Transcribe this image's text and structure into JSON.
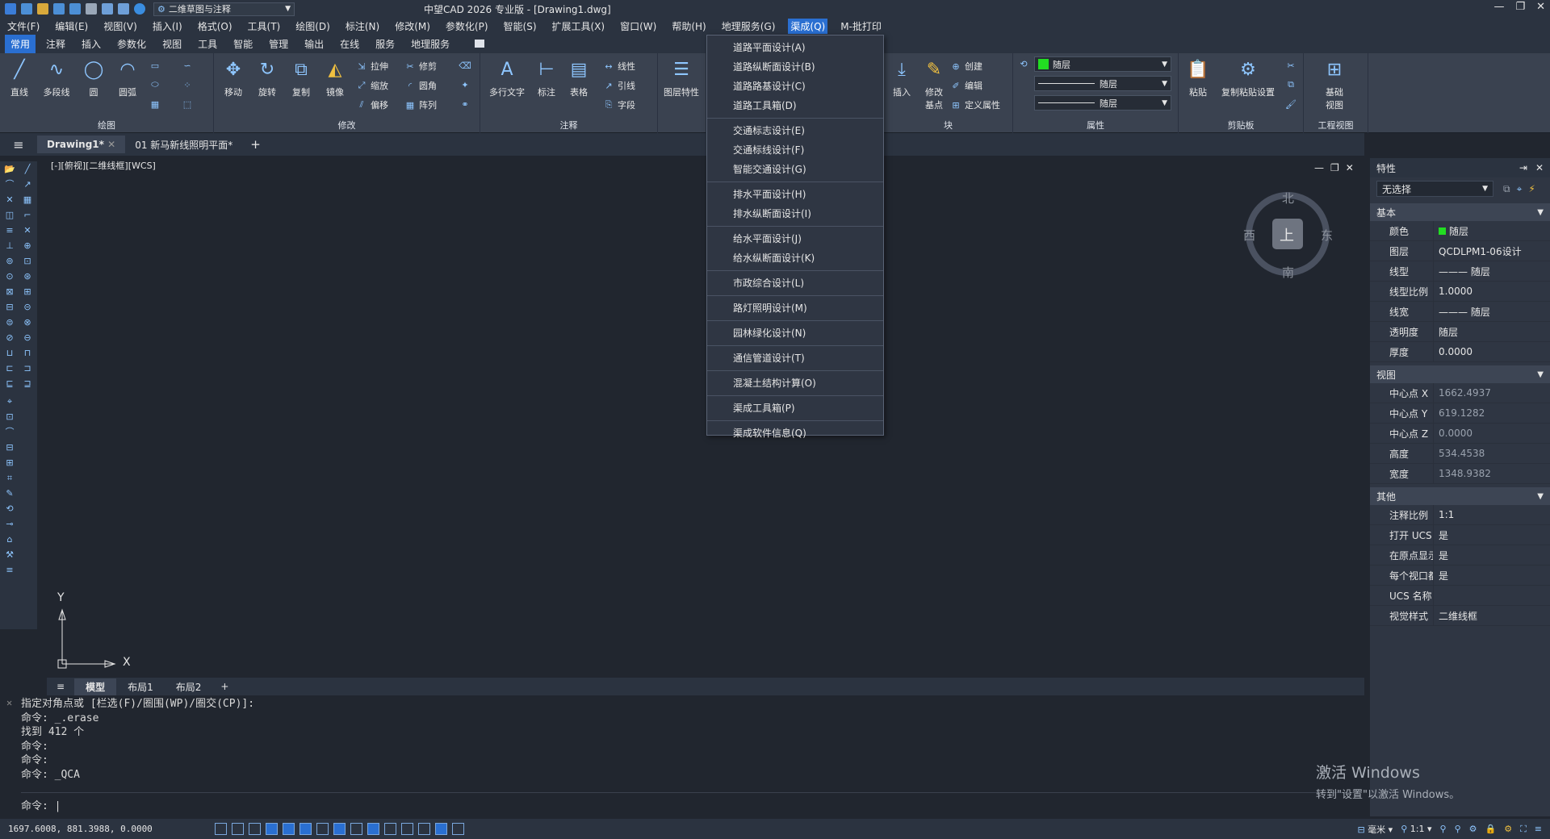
{
  "window": {
    "workspace": "二维草图与注释",
    "title": "中望CAD 2026 专业版 - [Drawing1.dwg]",
    "controls": [
      "—",
      "❐",
      "✕"
    ]
  },
  "menubar": [
    "文件(F)",
    "编辑(E)",
    "视图(V)",
    "插入(I)",
    "格式(O)",
    "工具(T)",
    "绘图(D)",
    "标注(N)",
    "修改(M)",
    "参数化(P)",
    "智能(S)",
    "扩展工具(X)",
    "窗口(W)",
    "帮助(H)",
    "地理服务(G)",
    "渠成(Q)",
    "M-批打印"
  ],
  "ribbon_tabs": [
    "常用",
    "注释",
    "插入",
    "参数化",
    "视图",
    "工具",
    "智能",
    "管理",
    "输出",
    "在线",
    "服务",
    "地理服务"
  ],
  "ribbon": {
    "draw": {
      "label": "绘图",
      "line": "直线",
      "polyline": "多段线",
      "circle": "圆",
      "arc": "圆弧"
    },
    "modify": {
      "label": "修改",
      "move": "移动",
      "rotate": "旋转",
      "copy": "复制",
      "mirror": "镜像",
      "stretch": "拉伸",
      "scale": "缩放",
      "offset": "偏移",
      "trim": "修剪",
      "fillet": "圆角",
      "array": "阵列"
    },
    "annotate": {
      "label": "注释",
      "mtext": "多行文字",
      "dim": "标注",
      "table": "表格",
      "linear": "线性",
      "leader": "引线",
      "field": "字段"
    },
    "layer": {
      "props": "图层特性"
    },
    "block": {
      "label": "块",
      "insert": "插入",
      "edit_base": "修改\n基点",
      "create": "创建",
      "edit": "编辑",
      "define_attr": "定义属性"
    },
    "properties": {
      "label": "属性",
      "color": "随层",
      "linetype": "随层",
      "lineweight": "随层"
    },
    "clipboard": {
      "label": "剪贴板",
      "paste": "粘贴",
      "copy_paste_settings": "复制粘贴设置"
    },
    "engview": {
      "label": "工程视图",
      "base": "基础\n视图"
    }
  },
  "doctabs": [
    "Drawing1*",
    "01 新马新线照明平面*"
  ],
  "viewport_label": "[-][俯视][二维线框][WCS]",
  "viewcube": {
    "north": "北",
    "south": "南",
    "east": "东",
    "west": "西",
    "top": "上"
  },
  "ucs": {
    "x": "X",
    "y": "Y"
  },
  "dropdown": [
    [
      "道路平面设计(A)",
      "道路纵断面设计(B)",
      "道路路基设计(C)",
      "道路工具箱(D)"
    ],
    [
      "交通标志设计(E)",
      "交通标线设计(F)",
      "智能交通设计(G)"
    ],
    [
      "排水平面设计(H)",
      "排水纵断面设计(I)"
    ],
    [
      "给水平面设计(J)",
      "给水纵断面设计(K)"
    ],
    [
      "市政综合设计(L)"
    ],
    [
      "路灯照明设计(M)"
    ],
    [
      "园林绿化设计(N)"
    ],
    [
      "通信管道设计(T)"
    ],
    [
      "混凝土结构计算(O)"
    ],
    [
      "渠成工具箱(P)"
    ],
    [
      "渠成软件信息(Q)"
    ]
  ],
  "properties_panel": {
    "title": "特性",
    "selection": "无选择",
    "categories": [
      {
        "name": "基本",
        "rows": [
          [
            "颜色",
            "随层"
          ],
          [
            "图层",
            "QCDLPM1-06设计"
          ],
          [
            "线型",
            "——— 随层"
          ],
          [
            "线型比例",
            "1.0000"
          ],
          [
            "线宽",
            "——— 随层"
          ],
          [
            "透明度",
            "随层"
          ],
          [
            "厚度",
            "0.0000"
          ]
        ]
      },
      {
        "name": "视图",
        "rows": [
          [
            "中心点 X",
            "1662.4937"
          ],
          [
            "中心点 Y",
            "619.1282"
          ],
          [
            "中心点 Z",
            "0.0000"
          ],
          [
            "高度",
            "534.4538"
          ],
          [
            "宽度",
            "1348.9382"
          ]
        ]
      },
      {
        "name": "其他",
        "rows": [
          [
            "注释比例",
            "1:1"
          ],
          [
            "打开 UCS ...",
            "是"
          ],
          [
            "在原点显示 ...",
            "是"
          ],
          [
            "每个视口都...",
            "是"
          ],
          [
            "UCS 名称",
            ""
          ],
          [
            "视觉样式",
            "二维线框"
          ]
        ]
      }
    ]
  },
  "layout_tabs": [
    "模型",
    "布局1",
    "布局2"
  ],
  "command_log": [
    "指定对角点或 [栏选(F)/圈围(WP)/圈交(CP)]:",
    "命令: _.erase",
    "找到 412 个",
    "命令:",
    "命令:",
    "命令: _QCA"
  ],
  "command_prompt": "命令: |",
  "status": {
    "coords": "1697.6008, 881.3988, 0.0000",
    "unit": "毫米",
    "scale": "1:1"
  },
  "watermark": {
    "line1": "激活 Windows",
    "line2": "转到\"设置\"以激活 Windows。"
  },
  "colors": {
    "accent": "#2a6fd1",
    "canvas": "#21262f",
    "panel": "#2f3643",
    "green": "#22dd22"
  }
}
